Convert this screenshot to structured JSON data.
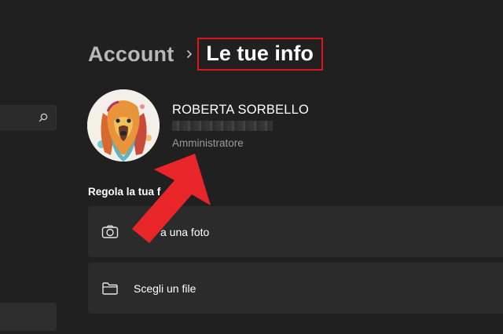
{
  "breadcrumb": {
    "root": "Account",
    "separator": "›",
    "current": "Le tue info"
  },
  "user": {
    "name": "ROBERTA SORBELLO",
    "role": "Amministratore"
  },
  "section": {
    "title": "Regola la tua f"
  },
  "options": [
    {
      "label": "a una foto",
      "icon": "camera-icon"
    },
    {
      "label": "Scegli un file",
      "icon": "folder-icon"
    }
  ],
  "colors": {
    "background": "#202020",
    "card": "#2b2b2b",
    "highlight_box": "#e0141c",
    "annotation_arrow": "#e8262a"
  }
}
